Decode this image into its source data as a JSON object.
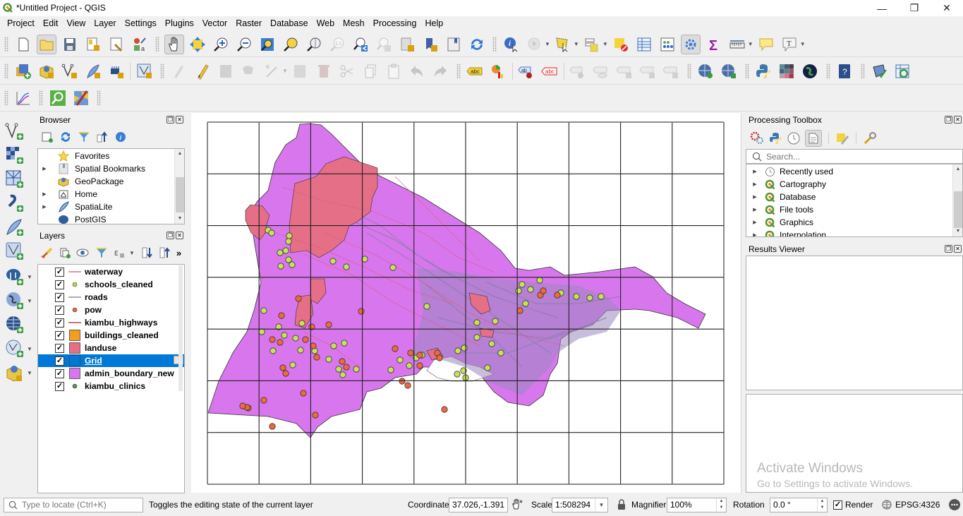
{
  "window": {
    "title": "*Untitled Project - QGIS",
    "controls": {
      "minimize": "—",
      "restore": "❐",
      "close": "✕"
    }
  },
  "menubar": [
    "Project",
    "Edit",
    "View",
    "Layer",
    "Settings",
    "Plugins",
    "Vector",
    "Raster",
    "Database",
    "Web",
    "Mesh",
    "Processing",
    "Help"
  ],
  "toolbars": {
    "row1": [
      "new-project-icon",
      "open-project-icon",
      "save-project-icon",
      "new-print-layout-icon",
      "layout-manager-icon",
      "style-manager-icon",
      "pan-icon",
      "pan-to-selection-icon",
      "zoom-in-icon",
      "zoom-out-icon",
      "zoom-full-icon",
      "zoom-to-selection-icon",
      "zoom-to-layer-icon",
      "zoom-native-icon",
      "zoom-last-icon",
      "zoom-next-icon",
      "new-map-view-icon",
      "new-bookmark-icon",
      "show-bookmarks-icon",
      "refresh-icon",
      "identify-icon",
      "run-action-icon",
      "select-features-icon",
      "select-by-value-icon",
      "deselect-icon",
      "attribute-table-icon",
      "field-calculator-icon",
      "processing-toolbox-icon",
      "statistics-sigma-icon",
      "measure-icon",
      "map-tips-icon",
      "text-annotation-icon"
    ],
    "row2": [
      "data-source-manager-icon",
      "new-geopackage-icon",
      "new-shapefile-icon",
      "new-spatialite-icon",
      "new-temp-scratch-icon",
      "new-virtual-layer-icon",
      "current-edits-icon",
      "toggle-editing-icon",
      "save-edits-icon",
      "add-feature-icon",
      "vertex-tool-icon",
      "modify-attributes-icon",
      "delete-selected-icon",
      "cut-icon",
      "copy-icon",
      "paste-icon",
      "undo-icon",
      "redo-icon",
      "label-toolbar-icon",
      "diagram-icon",
      "highlight-pin-labels-icon",
      "toggle-label-display-icon",
      "pin-labels-icon",
      "show-hide-labels-icon",
      "move-label-icon",
      "rotate-label-icon",
      "change-label-icon",
      "add-wms-icon",
      "add-wfs-icon",
      "python-console-icon",
      "raster-grid-icon",
      "globe-icon",
      "help-icon",
      "georeferencer-icon",
      "table-refresh-icon"
    ],
    "row3": [
      "profile-tool-icon",
      "locator-search-icon",
      "map-swipe-icon"
    ]
  },
  "status_tooltip": "Toggles the editing state of the current layer",
  "browser": {
    "title": "Browser",
    "items": [
      {
        "label": "Favorites",
        "icon": "star-icon",
        "expandable": false
      },
      {
        "label": "Spatial Bookmarks",
        "icon": "bookmark-icon",
        "expandable": true
      },
      {
        "label": "GeoPackage",
        "icon": "geopackage-icon",
        "expandable": false
      },
      {
        "label": "Home",
        "icon": "home-folder-icon",
        "expandable": true
      },
      {
        "label": "SpatiaLite",
        "icon": "feather-icon",
        "expandable": true
      },
      {
        "label": "PostGIS",
        "icon": "elephant-icon",
        "expandable": false
      }
    ]
  },
  "layers": {
    "title": "Layers",
    "more": "»",
    "items": [
      {
        "name": "waterway",
        "type": "line",
        "color": "#d6729c",
        "checked": true,
        "selected": false
      },
      {
        "name": "schools_cleaned",
        "type": "point",
        "color": "#b6d64a",
        "checked": true,
        "selected": false
      },
      {
        "name": "roads",
        "type": "line",
        "color": "#9a88c0",
        "checked": true,
        "selected": false
      },
      {
        "name": "pow",
        "type": "point",
        "color": "#e56b3d",
        "checked": true,
        "selected": false
      },
      {
        "name": "kiambu_highways",
        "type": "line",
        "color": "#c4404e",
        "checked": true,
        "selected": false
      },
      {
        "name": "buildings_cleaned",
        "type": "fill",
        "color": "#f39c1e",
        "checked": true,
        "selected": false
      },
      {
        "name": "landuse",
        "type": "fill",
        "color": "#e46f86",
        "checked": true,
        "selected": false
      },
      {
        "name": "Grid",
        "type": "fill",
        "color": "#0078d7",
        "checked": true,
        "selected": true
      },
      {
        "name": "admin_boundary_new",
        "type": "fill",
        "color": "#d877ed",
        "checked": true,
        "selected": false
      },
      {
        "name": "kiambu_clinics",
        "type": "point",
        "color": "#5f8c5a",
        "checked": true,
        "selected": false
      }
    ]
  },
  "processing": {
    "title": "Processing Toolbox",
    "search_placeholder": "Search...",
    "items": [
      {
        "label": "Recently used",
        "icon": "clock-icon"
      },
      {
        "label": "Cartography",
        "icon": "qgis-icon"
      },
      {
        "label": "Database",
        "icon": "qgis-icon"
      },
      {
        "label": "File tools",
        "icon": "qgis-icon"
      },
      {
        "label": "Graphics",
        "icon": "qgis-icon"
      },
      {
        "label": "Interpolation",
        "icon": "qgis-icon"
      }
    ]
  },
  "results_viewer": {
    "title": "Results Viewer"
  },
  "watermark": {
    "line1": "Activate Windows",
    "line2": "Go to Settings to activate Windows."
  },
  "map": {
    "colors": {
      "admin": "#d877ed",
      "landuse": "#e46f86",
      "roads": "#9a88c0",
      "schools": "#c8e05a",
      "pow": "#ee6a3a",
      "grid": "#222222"
    },
    "grid_cols": 10,
    "grid_rows": 7
  },
  "statusbar": {
    "locator_placeholder": "Type to locate (Ctrl+K)",
    "coordinate_label": "Coordinate",
    "coordinate_value": "37.026,-1.391",
    "scale_label": "Scale",
    "scale_value": "1:508294",
    "magnifier_label": "Magnifier",
    "magnifier_value": "100%",
    "rotation_label": "Rotation",
    "rotation_value": "0.0 °",
    "render_label": "Render",
    "render_checked": true,
    "crs": "EPSG:4326"
  }
}
